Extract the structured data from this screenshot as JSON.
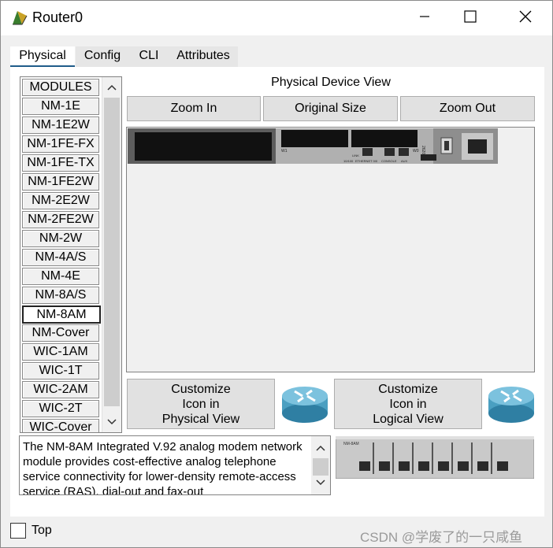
{
  "window": {
    "title": "Router0",
    "minimize_icon": "minimize-icon",
    "maximize_icon": "maximize-icon",
    "close_icon": "close-icon"
  },
  "tabs": [
    {
      "label": "Physical",
      "active": true
    },
    {
      "label": "Config",
      "active": false
    },
    {
      "label": "CLI",
      "active": false
    },
    {
      "label": "Attributes",
      "active": false
    }
  ],
  "modules": {
    "items": [
      "MODULES",
      "NM-1E",
      "NM-1E2W",
      "NM-1FE-FX",
      "NM-1FE-TX",
      "NM-1FE2W",
      "NM-2E2W",
      "NM-2FE2W",
      "NM-2W",
      "NM-4A/S",
      "NM-4E",
      "NM-8A/S",
      "NM-8AM",
      "NM-Cover",
      "WIC-1AM",
      "WIC-1T",
      "WIC-2AM",
      "WIC-2T",
      "WIC-Cover"
    ],
    "selected": "NM-8AM"
  },
  "physical_view": {
    "label": "Physical Device View",
    "zoom_in": "Zoom In",
    "original_size": "Original Size",
    "zoom_out": "Zoom Out",
    "router_face_labels": [
      "W1",
      "W0",
      "LINK",
      "10/100",
      "ETHERNET 0/0",
      "CONSOLE",
      "AUX",
      "2620XM"
    ]
  },
  "customize": {
    "physical_label": "Customize\nIcon in\nPhysical View",
    "logical_label": "Customize\nIcon in\nLogical View"
  },
  "description": "The NM-8AM Integrated V.92 analog modem network module provides cost-effective analog telephone service connectivity for lower-density remote-access service (RAS), dial-out and fax-out",
  "module_image_label": "NM-8AM",
  "footer": {
    "top_label": "Top",
    "watermark": "CSDN @学废了的一只咸鱼"
  },
  "colors": {
    "accent": "#1f5c8a",
    "panel": "#ffffff",
    "chrome": "#f0f0f0"
  }
}
